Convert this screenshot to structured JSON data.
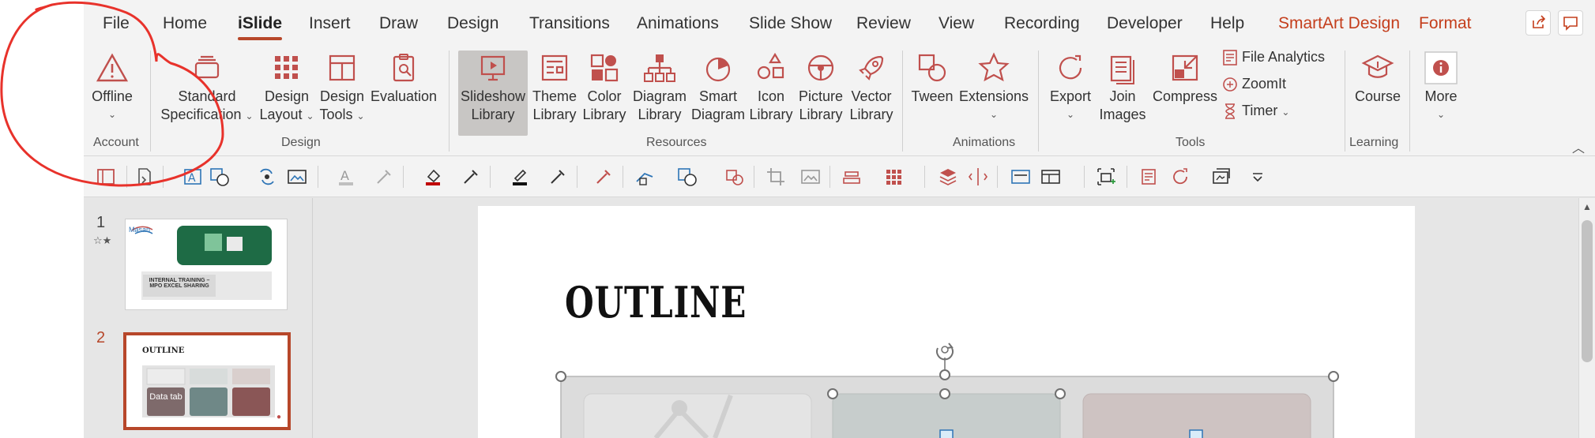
{
  "tabs": [
    {
      "label": "File"
    },
    {
      "label": "Home"
    },
    {
      "label": "iSlide",
      "active": true
    },
    {
      "label": "Insert"
    },
    {
      "label": "Draw"
    },
    {
      "label": "Design"
    },
    {
      "label": "Transitions"
    },
    {
      "label": "Animations"
    },
    {
      "label": "Slide Show"
    },
    {
      "label": "Review"
    },
    {
      "label": "View"
    },
    {
      "label": "Recording"
    },
    {
      "label": "Developer"
    },
    {
      "label": "Help"
    },
    {
      "label": "SmartArt Design",
      "contextual": true
    },
    {
      "label": "Format",
      "contextual": true
    }
  ],
  "ribbon": {
    "account": {
      "offline": "Offline",
      "group": "Account"
    },
    "design": {
      "standard1": "Standard",
      "standard2": "Specification",
      "layout1": "Design",
      "layout2": "Layout",
      "tools1": "Design",
      "tools2": "Tools",
      "evaluation": "Evaluation",
      "group": "Design"
    },
    "resources": {
      "slideshow1": "Slideshow",
      "slideshow2": "Library",
      "theme1": "Theme",
      "theme2": "Library",
      "color1": "Color",
      "color2": "Library",
      "diagram1": "Diagram",
      "diagram2": "Library",
      "smart1": "Smart",
      "smart2": "Diagram",
      "icon1": "Icon",
      "icon2": "Library",
      "picture1": "Picture",
      "picture2": "Library",
      "vector1": "Vector",
      "vector2": "Library",
      "group": "Resources"
    },
    "animations": {
      "tween": "Tween",
      "extensions": "Extensions",
      "group": "Animations"
    },
    "tools": {
      "export": "Export",
      "join1": "Join",
      "join2": "Images",
      "compress": "Compress",
      "file_analytics": "File Analytics",
      "zoomit": "ZoomIt",
      "timer": "Timer",
      "group": "Tools"
    },
    "learning": {
      "course": "Course",
      "group": "Learning"
    },
    "more": "More"
  },
  "slides": [
    {
      "number": "1",
      "title": "INTERNAL TRAINING – MPO EXCEL SHARING",
      "logo": "Masan"
    },
    {
      "number": "2",
      "title": "OUTLINE",
      "cell": "Data tab"
    }
  ],
  "slide": {
    "title": "OUTLINE"
  },
  "colors": {
    "accent": "#b7472a",
    "contextual": "#c43e1c",
    "icon_red": "#c0504d",
    "annotation": "#e8322b"
  }
}
